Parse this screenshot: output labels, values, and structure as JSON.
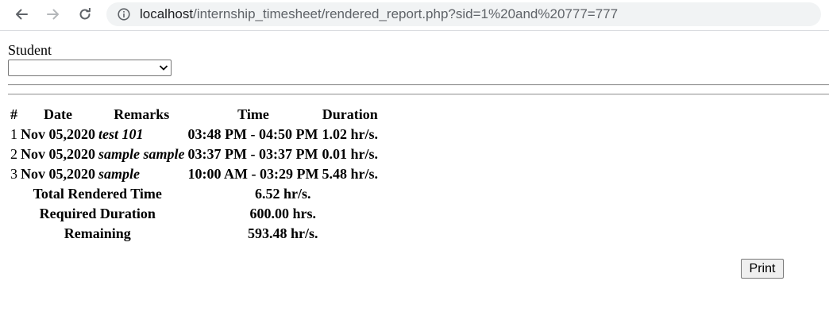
{
  "browser": {
    "url_host": "localhost",
    "url_path": "/internship_timesheet/rendered_report.php?sid=1%20and%20777=777"
  },
  "form": {
    "student_label": "Student",
    "student_value": ""
  },
  "table": {
    "headers": [
      "#",
      "Date",
      "Remarks",
      "Time",
      "Duration"
    ],
    "rows": [
      {
        "num": "1",
        "date": "Nov 05,2020",
        "remarks": "test 101",
        "time": "03:48 PM - 04:50 PM",
        "duration": "1.02 hr/s."
      },
      {
        "num": "2",
        "date": "Nov 05,2020",
        "remarks": "sample sample",
        "time": "03:37 PM - 03:37 PM",
        "duration": "0.01 hr/s."
      },
      {
        "num": "3",
        "date": "Nov 05,2020",
        "remarks": "sample",
        "time": "10:00 AM - 03:29 PM",
        "duration": "5.48 hr/s."
      }
    ],
    "summary": [
      {
        "label": "Total Rendered Time",
        "value": "6.52 hr/s."
      },
      {
        "label": "Required Duration",
        "value": "600.00 hrs."
      },
      {
        "label": "Remaining",
        "value": "593.48 hr/s."
      }
    ]
  },
  "actions": {
    "print_label": "Print"
  },
  "icons": {
    "back": "back-arrow-icon",
    "forward": "forward-arrow-icon",
    "reload": "reload-icon",
    "info": "info-icon",
    "dropdown": "chevron-down-icon"
  }
}
